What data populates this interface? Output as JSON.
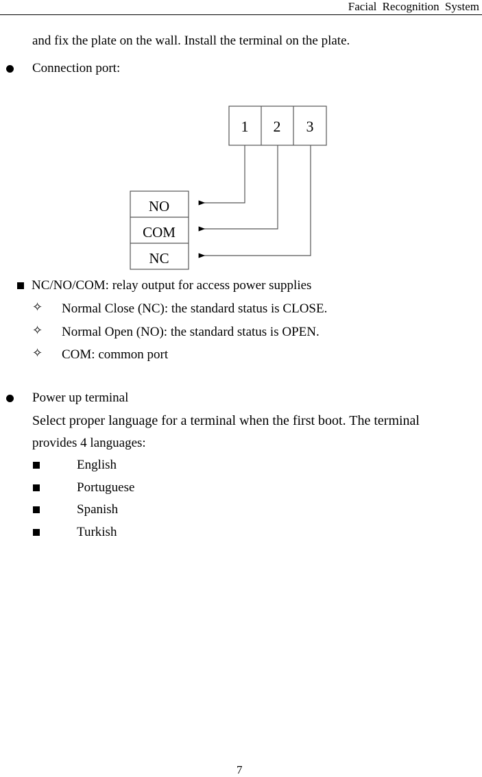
{
  "header": {
    "title": "Facial Recognition System"
  },
  "intro": {
    "text": "and fix the plate on the wall. Install the terminal on the plate."
  },
  "connection": {
    "heading": "Connection port:",
    "diagram": {
      "terminal_ports": [
        "1",
        "2",
        "3"
      ],
      "relay_ports": [
        "NO",
        "COM",
        "NC"
      ],
      "connections": [
        {
          "from": "1",
          "to": "NO"
        },
        {
          "from": "2",
          "to": "COM"
        },
        {
          "from": "3",
          "to": "NC"
        }
      ]
    },
    "relay_title": "NC/NO/COM: relay output for access power supplies",
    "relay_items": [
      "Normal Close (NC): the standard status is CLOSE.",
      "Normal Open (NO): the standard status is OPEN.",
      "COM: common port"
    ]
  },
  "power": {
    "heading": "Power up terminal",
    "description_line1": "Select proper language for a terminal when the first boot. The terminal",
    "description_line2": "provides 4 languages:",
    "languages": [
      "English",
      "Portuguese",
      "Spanish",
      "Turkish"
    ]
  },
  "footer": {
    "page_number": "7"
  }
}
